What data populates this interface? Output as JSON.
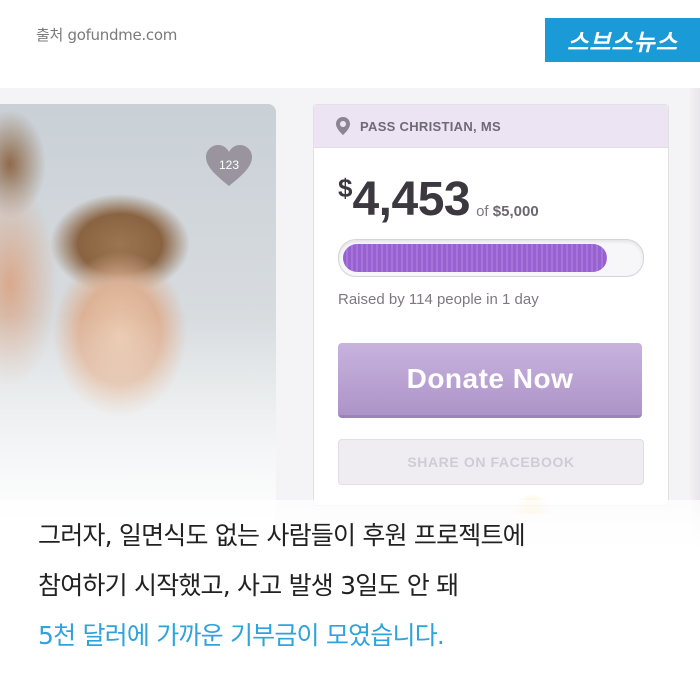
{
  "source": "출처 gofundme.com",
  "logo": "스브스뉴스",
  "photo": {
    "heart_count": "123"
  },
  "card": {
    "location": "PASS CHRISTIAN, MS",
    "currency": "$",
    "amount": "4,453",
    "goal_prefix": "of",
    "goal": "$5,000",
    "progress_fraction": 0.8906,
    "raised_text": "Raised by 114 people in 1 day",
    "donate_label": "Donate Now",
    "share_label": "SHARE ON FACEBOOK"
  },
  "caption": {
    "line1": "그러자, 일면식도 없는 사람들이 후원 프로젝트에",
    "line2": "참여하기 시작했고, 사고 발생 3일도 안 돼",
    "line3": "5천 달러에 가까운 기부금이 모였습니다."
  },
  "colors": {
    "accent_blue": "#2fa3dc",
    "logo_blue": "#1a9ad6",
    "progress_purple": "#9861d0",
    "donate_purple": "#ad94c8"
  }
}
